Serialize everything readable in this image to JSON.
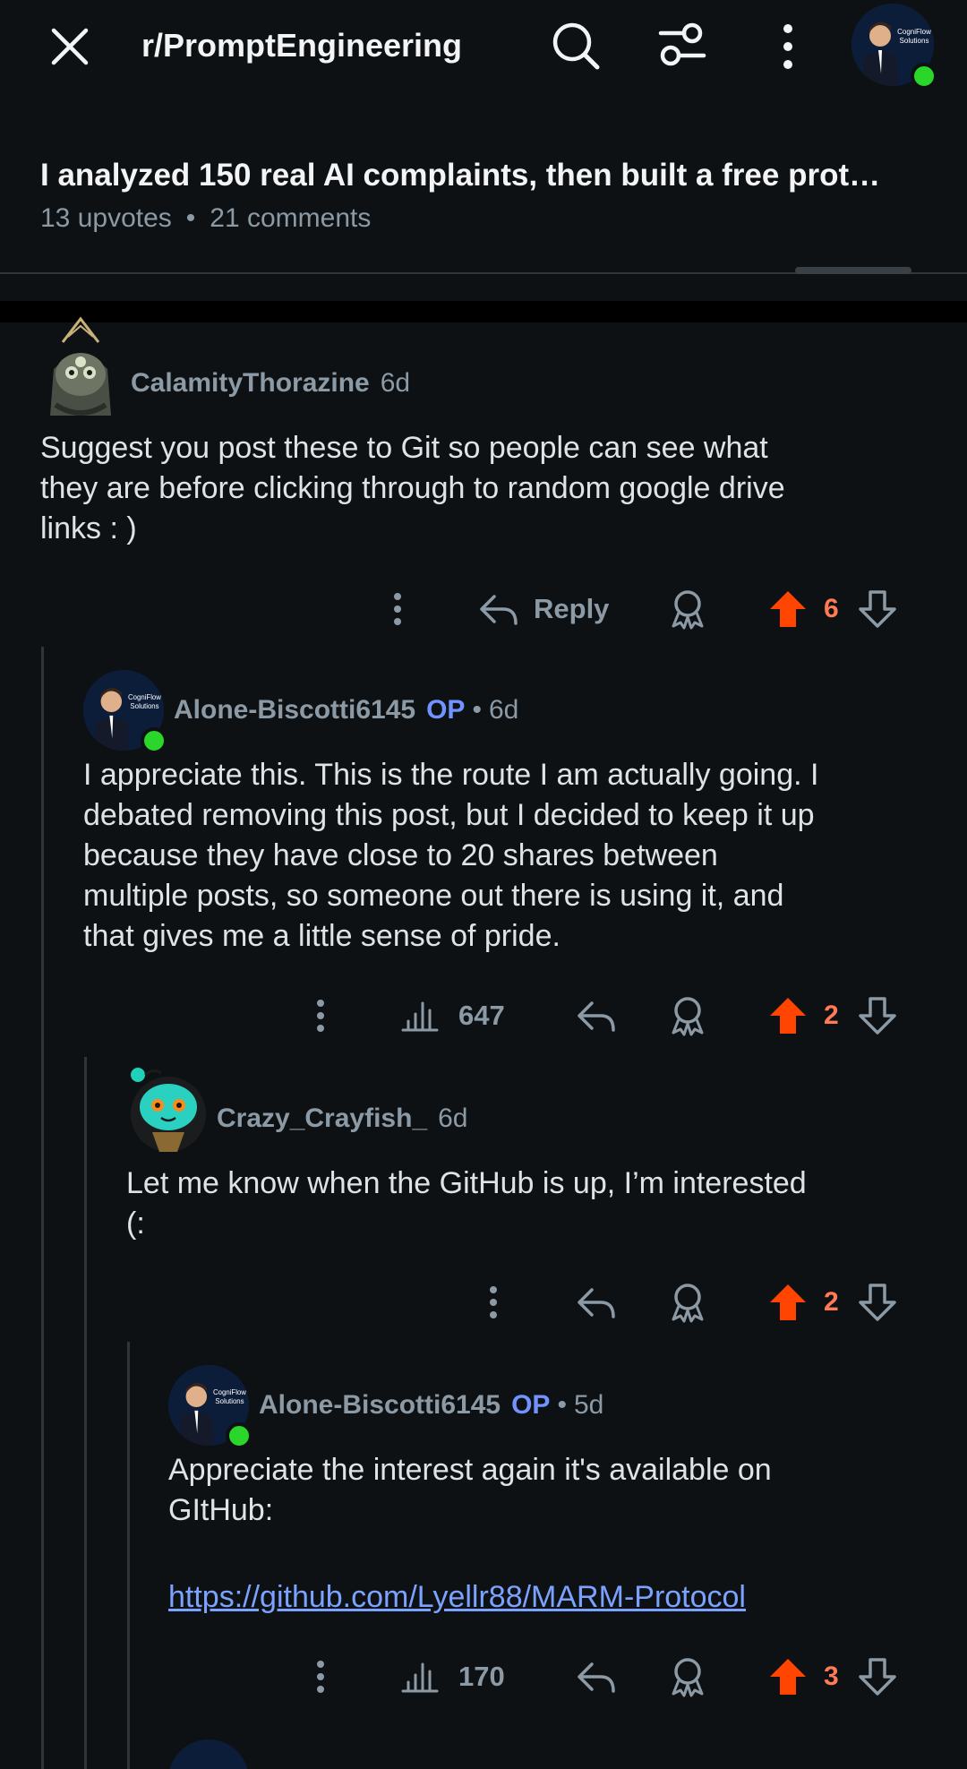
{
  "header": {
    "subreddit": "r/PromptEngineering",
    "close_icon": "close-icon",
    "search_icon": "search-icon",
    "filter_icon": "sort-filter-icon",
    "more_icon": "more-vertical-icon",
    "avatar_label": "CogniFlow Solutions"
  },
  "post": {
    "title": "I analyzed 150 real AI complaints, then built a free prot…",
    "upvotes": "13 upvotes",
    "dot": "•",
    "comments": "21 comments"
  },
  "comments": [
    {
      "username": "CalamityThorazine",
      "age": "6d",
      "body": "Suggest you post these to Git so people can see what\nthey are before clicking through to random google drive\nlinks : )",
      "reply_label": "Reply",
      "votes": "6"
    },
    {
      "username": "Alone-Biscotti6145",
      "op": "OP",
      "sep": "•",
      "age": "6d",
      "body": "I appreciate this. This is the route I am actually going. I\ndebated removing this post, but I decided to keep it up\nbecause they have close to 20 shares between\nmultiple posts, so someone out there is using it, and\nthat gives me a little sense of pride.",
      "views": "647",
      "votes": "2"
    },
    {
      "username": "Crazy_Crayfish_",
      "age": "6d",
      "body": "Let me know when the GitHub is up, I’m interested\n(:",
      "votes": "2"
    },
    {
      "username": "Alone-Biscotti6145",
      "op": "OP",
      "sep": "•",
      "age": "5d",
      "body": "Appreciate the interest again it's available on\nGItHub:",
      "link": "https://github.com/Lyellr88/MARM-Protocol",
      "views": "170",
      "votes": "3"
    }
  ],
  "colors": {
    "background": "#0e1113",
    "upvote_active": "#ff4500",
    "vote_count": "#ff7a55",
    "op_badge": "#7193ff",
    "link": "#7ca2ff",
    "online": "#2bd62b"
  }
}
